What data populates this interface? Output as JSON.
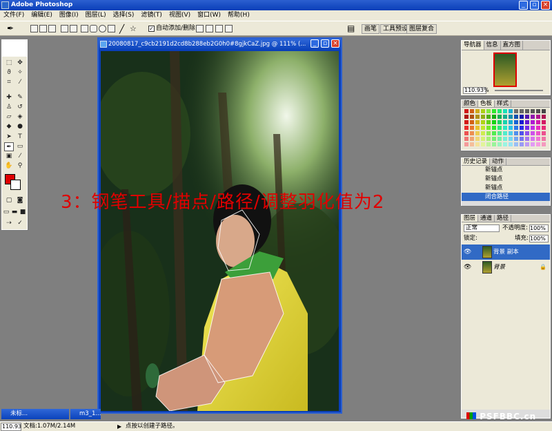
{
  "app": {
    "title": "Adobe Photoshop"
  },
  "menu": [
    "文件(F)",
    "编辑(E)",
    "图像(I)",
    "图层(L)",
    "选择(S)",
    "滤镜(T)",
    "视图(V)",
    "窗口(W)",
    "帮助(H)"
  ],
  "options": {
    "auto_add_delete": "自动添加/删除",
    "auto_add_checked": true,
    "tabs": [
      "画笔",
      "工具预设",
      "图层复合"
    ]
  },
  "document": {
    "title": "20080817_c9cb2191d2cd8b288eb2G0h0#8gjkCaZ.jpg @ 111% (...",
    "caption": "3：钢笔工具/描点/路径/调整羽化值为2"
  },
  "navigator": {
    "tabs": [
      "导航器",
      "信息",
      "直方图"
    ],
    "zoom": "110.93%"
  },
  "swatches": {
    "tabs": [
      "颜色",
      "色板",
      "样式"
    ]
  },
  "history": {
    "tabs": [
      "历史记录",
      "动作"
    ],
    "items": [
      "新锚点",
      "新锚点",
      "新锚点",
      "闭合路径"
    ]
  },
  "layers": {
    "tabs": [
      "图层",
      "通道",
      "路径"
    ],
    "mode": "正常",
    "opacity_label": "不透明度:",
    "opacity": "100%",
    "lock_label": "锁定:",
    "fill_label": "填充:",
    "fill": "100%",
    "items": [
      {
        "name": "背景 副本",
        "selected": true
      },
      {
        "name": "背景",
        "selected": false
      }
    ]
  },
  "minimized": [
    "未标...",
    "m3_1..."
  ],
  "status": {
    "zoom": "110.93",
    "doc": "文档:1.07M/2.14M",
    "hint": "点按以创建子路径。"
  },
  "watermark": "PSFBBC.cn",
  "colors": {
    "foreground": "#e00000",
    "background": "#ffffff",
    "titlebar": "#0a3fb8",
    "selection": "#316ac5"
  }
}
